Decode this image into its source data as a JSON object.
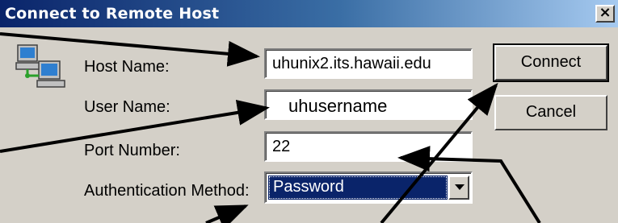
{
  "window": {
    "title": "Connect to Remote Host",
    "close_glyph": "×"
  },
  "icon": {
    "name": "network-computers-icon"
  },
  "form": {
    "host_label": "Host Name:",
    "host_value": "uhunix2.its.hawaii.edu",
    "user_label": "User Name:",
    "user_value": "",
    "user_annotation": "uhusername",
    "port_label": "Port Number:",
    "port_value": "22",
    "auth_label": "Authentication Method:",
    "auth_value": "Password"
  },
  "buttons": {
    "connect": "Connect",
    "cancel": "Cancel"
  },
  "colors": {
    "title_bar_start": "#0a246a",
    "title_bar_end": "#a6caf0",
    "dialog_bg": "#d4d0c8",
    "selection": "#0a246a"
  }
}
